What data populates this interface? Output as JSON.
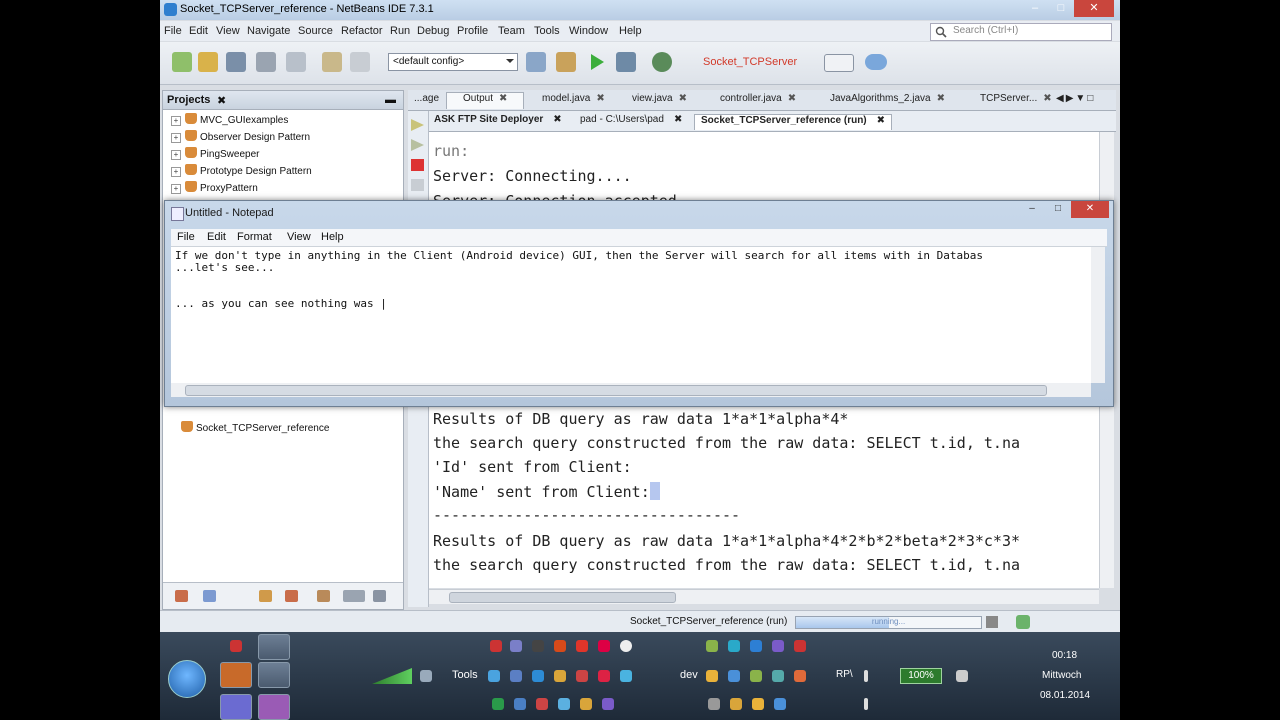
{
  "window": {
    "title": "Socket_TCPServer_reference - NetBeans IDE 7.3.1"
  },
  "menu": [
    "File",
    "Edit",
    "View",
    "Navigate",
    "Source",
    "Refactor",
    "Run",
    "Debug",
    "Profile",
    "Team",
    "Tools",
    "Window",
    "Help"
  ],
  "search": {
    "placeholder": "Search (Ctrl+I)"
  },
  "toolbar": {
    "config": "<default config>",
    "project": "Socket_TCPServer"
  },
  "projects": {
    "header": "Projects",
    "items": [
      "MVC_GUIexamples",
      "Observer Design Pattern",
      "PingSweeper",
      "Prototype Design Pattern",
      "ProxyPattern"
    ],
    "lower_item": "Socket_TCPServer_reference"
  },
  "tabs": [
    {
      "label": "...age"
    },
    {
      "label": "Output"
    },
    {
      "label": "model.java"
    },
    {
      "label": "view.java"
    },
    {
      "label": "controller.java"
    },
    {
      "label": "JavaAlgorithms_2.java"
    },
    {
      "label": "TCPServer..."
    }
  ],
  "output_tabs": [
    {
      "label": "ASK FTP Site Deployer"
    },
    {
      "label": "pad - C:\\Users\\pad"
    },
    {
      "label": "Socket_TCPServer_reference (run)"
    }
  ],
  "output": {
    "line1": "run:",
    "line2": "Server: Connecting....",
    "line3": "Server: Connection accepted",
    "line4": "Results of DB query as raw data 1*a*1*alpha*4*",
    "line5": "the search query constructed from the raw data: SELECT t.id, t.na",
    "line6": "'Id' sent from Client:",
    "line7": "'Name' sent from Client:",
    "line8": "----------------------------------",
    "line9": "Results of DB query as raw data 1*a*1*alpha*4*2*b*2*beta*2*3*c*3*",
    "line10": "the search query constructed from the raw data: SELECT t.id, t.na"
  },
  "status": {
    "text": "Socket_TCPServer_reference (run)",
    "progress_label": "running...",
    "progress": 0.5
  },
  "notepad": {
    "title": "Untitled - Notepad",
    "menu": [
      "File",
      "Edit",
      "Format",
      "View",
      "Help"
    ],
    "line1": "If we don't type in anything in the Client (Android device) GUI, then the Server will search for all items with in Databas",
    "line2": "...let's see...",
    "line3": "... as you can see nothing was |"
  },
  "taskbar": {
    "tools_label": "Tools",
    "dev_label": "dev",
    "rp_label": "RP\\",
    "battery": "100%",
    "time": "00:18",
    "day": "Mittwoch",
    "date": "08.01.2014"
  }
}
